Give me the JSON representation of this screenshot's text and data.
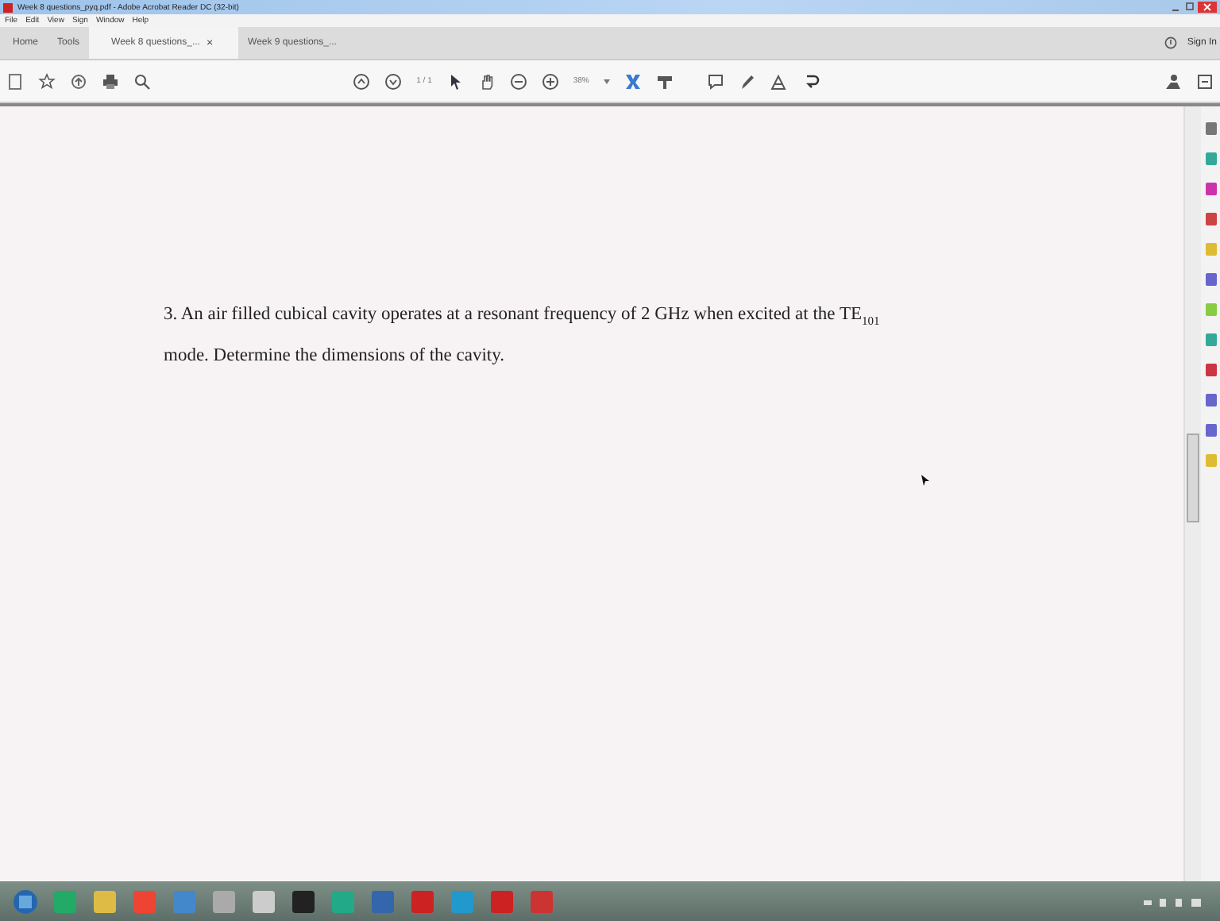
{
  "window": {
    "title": "Week 8 questions_pyq.pdf - Adobe Acrobat Reader DC (32-bit)"
  },
  "menu": [
    "File",
    "Edit",
    "View",
    "Sign",
    "Window",
    "Help"
  ],
  "tabs": [
    {
      "label": "Home",
      "selected": false
    },
    {
      "label": "Tools",
      "selected": false
    },
    {
      "label": "Week 8 questions_...",
      "selected": true,
      "close": "×"
    },
    {
      "label": "Week 9 questions_...",
      "selected": false
    }
  ],
  "sign_in": "Sign In",
  "toolbar": {
    "page": "1 / 1",
    "zoom": "38%"
  },
  "document": {
    "paragraph": "3. An air filled cubical cavity operates at a resonant frequency of 2 GHz when excited at the TE$_{101}$ mode. Determine the dimensions of the cavity."
  }
}
